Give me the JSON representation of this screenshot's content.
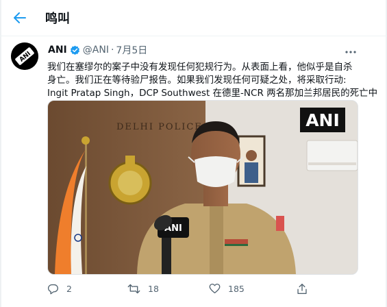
{
  "header": {
    "title": "鸣叫"
  },
  "tweet": {
    "author_name": "ANI",
    "handle": "@ANI",
    "separator": "·",
    "date": "7月5日",
    "avatar_text": "ANI",
    "text_lines": [
      "我们在塞缪尔的案子中没有发现任何犯规行为。从表面上看，他似乎是自杀",
      "身亡。我们正在等待验尸报告。如果我们发现任何可疑之处，将采取行动:",
      "Ingit Pratap Singh，DCP Southwest 在德里-NCR 两名那加兰邦居民的死亡中"
    ],
    "media": {
      "watermark": "ANI",
      "mic_label": "ANI",
      "wall_sign": "DELHI POLICE"
    },
    "actions": {
      "replies": "2",
      "retweets": "18",
      "likes": "185"
    }
  },
  "colors": {
    "accent": "#1d9bf0",
    "text": "#0f1419",
    "secondary": "#536471"
  }
}
